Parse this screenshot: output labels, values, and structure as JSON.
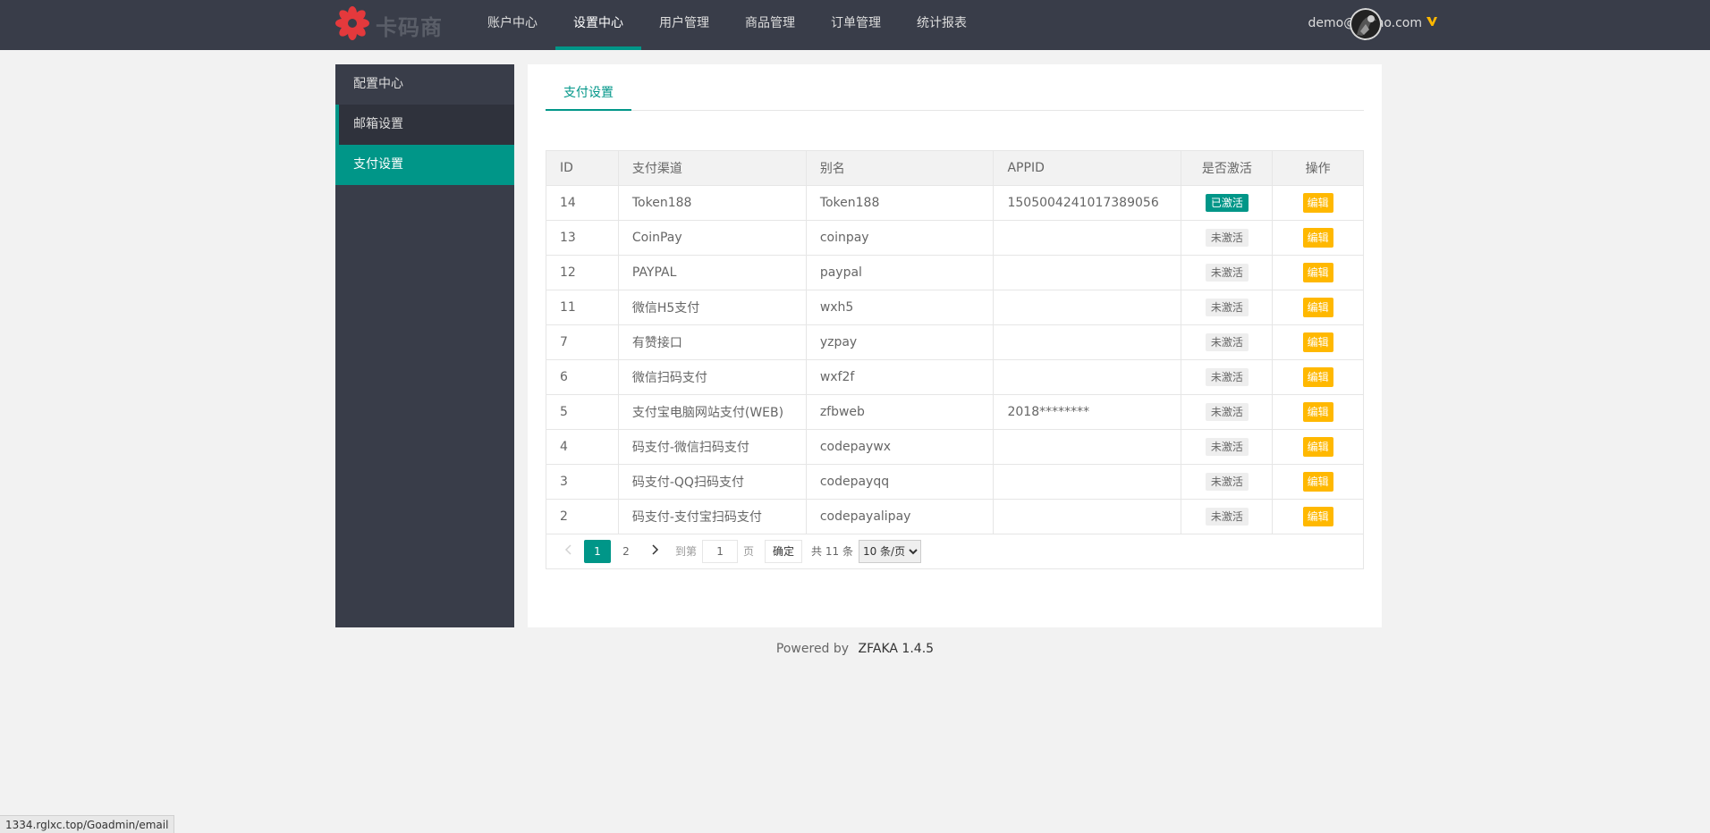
{
  "header": {
    "logo_text": "卡码商",
    "nav": [
      {
        "label": "账户中心",
        "active": false
      },
      {
        "label": "设置中心",
        "active": true
      },
      {
        "label": "用户管理",
        "active": false
      },
      {
        "label": "商品管理",
        "active": false
      },
      {
        "label": "订单管理",
        "active": false
      },
      {
        "label": "统计报表",
        "active": false
      }
    ],
    "user_email": "demo@demo.com"
  },
  "sidebar": {
    "items": [
      {
        "label": "配置中心"
      },
      {
        "label": "邮箱设置"
      },
      {
        "label": "支付设置"
      }
    ]
  },
  "main": {
    "tab": "支付设置",
    "table": {
      "headers": [
        "ID",
        "支付渠道",
        "别名",
        "APPID",
        "是否激活",
        "操作"
      ],
      "rows": [
        {
          "id": "14",
          "channel": "Token188",
          "alias": "Token188",
          "appid": "1505004241017389056",
          "status": "已激活",
          "active": true,
          "action": "编辑"
        },
        {
          "id": "13",
          "channel": "CoinPay",
          "alias": "coinpay",
          "appid": "",
          "status": "未激活",
          "active": false,
          "action": "编辑"
        },
        {
          "id": "12",
          "channel": "PAYPAL",
          "alias": "paypal",
          "appid": "",
          "status": "未激活",
          "active": false,
          "action": "编辑"
        },
        {
          "id": "11",
          "channel": "微信H5支付",
          "alias": "wxh5",
          "appid": "",
          "status": "未激活",
          "active": false,
          "action": "编辑"
        },
        {
          "id": "7",
          "channel": "有赞接口",
          "alias": "yzpay",
          "appid": "",
          "status": "未激活",
          "active": false,
          "action": "编辑"
        },
        {
          "id": "6",
          "channel": "微信扫码支付",
          "alias": "wxf2f",
          "appid": "",
          "status": "未激活",
          "active": false,
          "action": "编辑"
        },
        {
          "id": "5",
          "channel": "支付宝电脑网站支付(WEB)",
          "alias": "zfbweb",
          "appid": "2018********",
          "status": "未激活",
          "active": false,
          "action": "编辑"
        },
        {
          "id": "4",
          "channel": "码支付-微信扫码支付",
          "alias": "codepaywx",
          "appid": "",
          "status": "未激活",
          "active": false,
          "action": "编辑"
        },
        {
          "id": "3",
          "channel": "码支付-QQ扫码支付",
          "alias": "codepayqq",
          "appid": "",
          "status": "未激活",
          "active": false,
          "action": "编辑"
        },
        {
          "id": "2",
          "channel": "码支付-支付宝扫码支付",
          "alias": "codepayalipay",
          "appid": "",
          "status": "未激活",
          "active": false,
          "action": "编辑"
        }
      ]
    },
    "pager": {
      "pages": [
        "1",
        "2"
      ],
      "current": "1",
      "goto_label": "到第",
      "goto_value": "1",
      "page_unit": "页",
      "confirm": "确定",
      "total": "共 11 条",
      "per_page": "10 条/页"
    }
  },
  "footer": {
    "powered": "Powered by",
    "name": "ZFAKA 1.4.5"
  },
  "statusbar": "1334.rglxc.top/Goadmin/email",
  "colors": {
    "header_bg": "#393d49",
    "accent": "#009688",
    "warn": "#ffb800"
  }
}
